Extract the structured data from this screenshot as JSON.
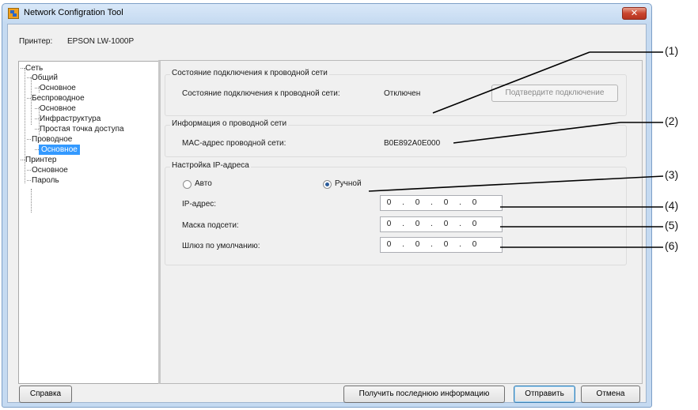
{
  "window": {
    "title": "Network Configration Tool",
    "close_symbol": "✕"
  },
  "printer": {
    "label": "Принтер:",
    "value": "EPSON LW-1000P"
  },
  "tree": {
    "items": [
      "Сеть",
      "Общий",
      "Основное",
      "Беспроводное",
      "Основное",
      "Инфраструктура",
      "Простая точка доступа",
      "Проводное",
      "Основное",
      "Принтер",
      "Основное",
      "Пароль"
    ],
    "selected_index": 8
  },
  "wired_status": {
    "group_title": "Состояние подключения к проводной сети",
    "label": "Состояние подключения к проводной сети:",
    "value": "Отключен",
    "confirm_button": "Подтвердите подключение"
  },
  "wired_info": {
    "group_title": "Информация о проводной сети",
    "mac_label": "MAC-адрес проводной сети:",
    "mac_value": "B0E892A0E000"
  },
  "ip_settings": {
    "group_title": "Настройка IP-адреса",
    "auto_label": "Авто",
    "manual_label": "Ручной",
    "selected_mode": "manual",
    "ip_label": "IP-адрес:",
    "ip_value": [
      "0",
      "0",
      "0",
      "0"
    ],
    "mask_label": "Маска подсети:",
    "mask_value": [
      "0",
      "0",
      "0",
      "0"
    ],
    "gateway_label": "Шлюз по умолчанию:",
    "gateway_value": [
      "0",
      "0",
      "0",
      "0"
    ]
  },
  "footer": {
    "help_button": "Справка",
    "refresh_button": "Получить последнюю информацию",
    "send_button": "Отправить",
    "cancel_button": "Отмена"
  },
  "callouts": [
    "(1)",
    "(2)",
    "(3)",
    "(4)",
    "(5)",
    "(6)"
  ]
}
